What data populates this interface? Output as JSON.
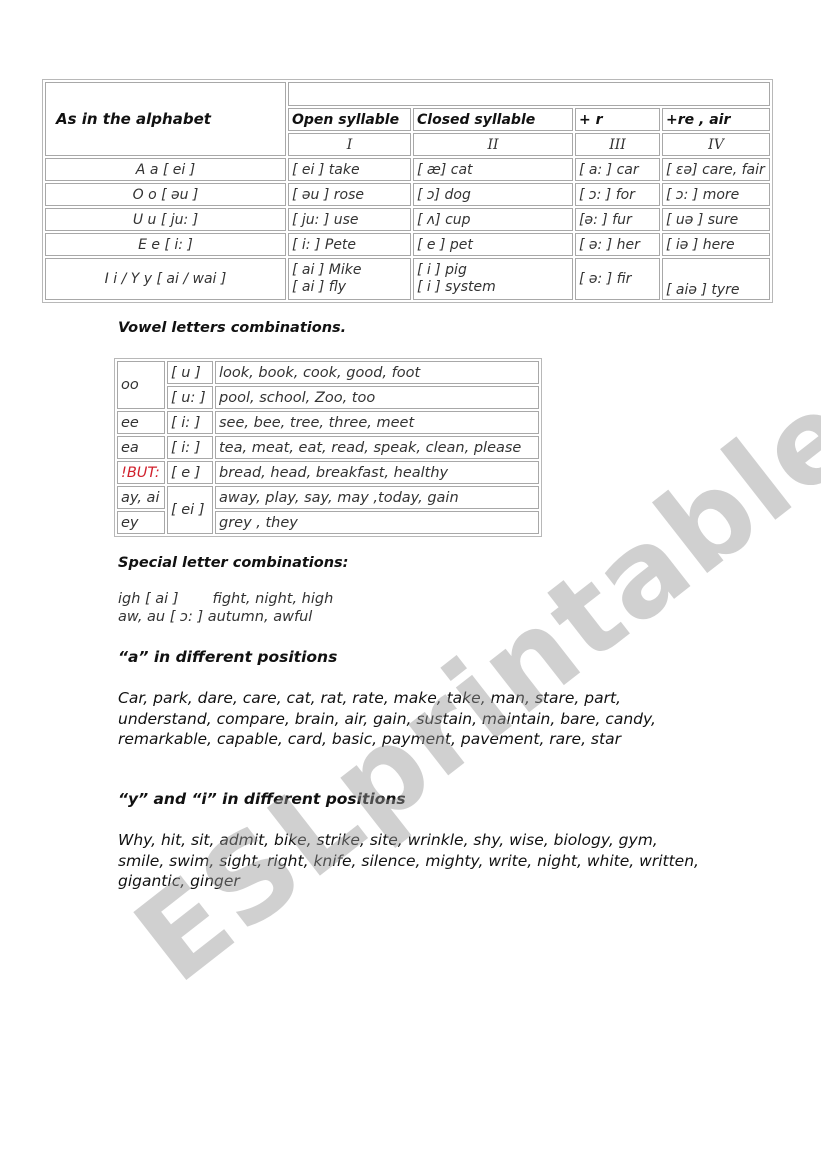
{
  "table1": {
    "corner_label": "As in the alphabet",
    "headers": [
      "Open syllable",
      "Closed syllable",
      "+ r",
      "+re , air"
    ],
    "numerals": [
      "I",
      "II",
      "III",
      "IV"
    ],
    "rows": [
      {
        "letter": "A a [ ei ]",
        "cells": [
          "[ ei ] take",
          "[ æ] cat",
          "[ a: ] car",
          "[ ɛə] care, fair"
        ]
      },
      {
        "letter": "O o [ əu ]",
        "cells": [
          "[ əu ] rose",
          "[ ɔ] dog",
          "[ ɔ: ] for",
          "[ ɔ: ] more"
        ]
      },
      {
        "letter": "U u [ ju: ]",
        "cells": [
          "[ ju: ] use",
          "[ ʌ] cup",
          "[ə: ] fur",
          "[ uə ] sure"
        ]
      },
      {
        "letter": "E e [ i: ]",
        "cells": [
          "[ i: ] Pete",
          "[ e ] pet",
          "[ ə: ] her",
          "[ iə ] here"
        ]
      },
      {
        "letter": "I i / Y y [ ai / wai ]",
        "cells": [
          "[ ai ] Mike",
          "[ i ] pig",
          "[ ə: ] fir",
          "[ aiə ] tyre"
        ],
        "cells2": [
          "[ ai ] fly",
          "[ i ] system"
        ]
      }
    ]
  },
  "vowel_section": {
    "title": "Vowel letters combinations.",
    "rows": [
      {
        "combo": "oo",
        "sound": "[ u ]",
        "words": "look, book, cook, good, foot"
      },
      {
        "combo": "",
        "sound": "[ u: ]",
        "words": "pool, school, Zoo, too"
      },
      {
        "combo": "ee",
        "sound": "[ i: ]",
        "words": "see, bee, tree, three, meet"
      },
      {
        "combo": "ea",
        "sound": "[ i: ]",
        "words": "tea, meat, eat, read, speak, clean, please"
      },
      {
        "combo": "!BUT:",
        "sound": "[ e ]",
        "words": "bread, head, breakfast, healthy"
      },
      {
        "combo": "ay, ai",
        "sound": "[ ei ]",
        "words": "away, play, say, may ,today, gain"
      },
      {
        "combo": "ey",
        "sound": "",
        "words": "grey , they"
      }
    ],
    "warning_color": "#d0202c"
  },
  "special_section": {
    "title": "Special letter combinations:",
    "lines": [
      {
        "combo": "igh [ ai ]",
        "words": "fight, night, high"
      },
      {
        "combo": "aw, au [ ɔ: ]",
        "words": "autumn, awful"
      }
    ]
  },
  "a_section": {
    "title": "“a” in different positions",
    "lines": [
      "Car, park, dare, care, cat, rat, rate, make, take, man, stare, part,",
      "understand, compare, brain, air, gain, sustain, maintain, bare, candy,",
      "remarkable, capable, card, basic, payment, pavement, rare, star"
    ]
  },
  "yi_section": {
    "title": "“y” and “i” in different positions",
    "lines": [
      "Why, hit, sit, admit, bike, strike, site, wrinkle, shy, wise, biology, gym,",
      "smile, swim, sight, right, knife, silence, mighty, write, night, white, written,",
      "gigantic, ginger"
    ]
  },
  "watermark": "ESLprintables.com"
}
